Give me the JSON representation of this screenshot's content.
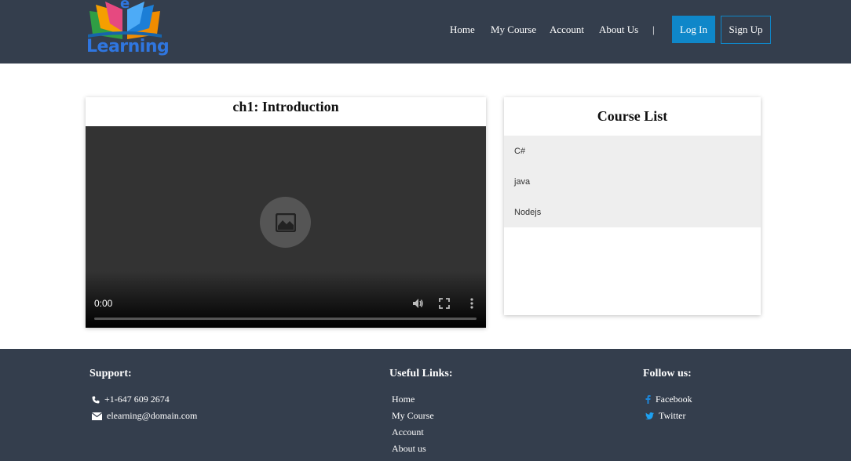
{
  "logo": {
    "letter": "e",
    "word": "Learning"
  },
  "nav": {
    "items": [
      "Home",
      "My Course",
      "Account",
      "About Us"
    ],
    "separator": "|",
    "login_label": "Log In",
    "signup_label": "Sign Up"
  },
  "video": {
    "title": "ch1: Introduction",
    "time": "0:00",
    "progress": 0
  },
  "course_list": {
    "title": "Course List",
    "items": [
      "C#",
      "java",
      "Nodejs"
    ]
  },
  "footer": {
    "support": {
      "heading": "Support:",
      "phone": "+1-647 609 2674",
      "email": "elearning@domain.com"
    },
    "links": {
      "heading": "Useful Links:",
      "items": [
        "Home",
        "My Course",
        "Account",
        "About us"
      ]
    },
    "follow": {
      "heading": "Follow us:",
      "items": [
        "Facebook",
        "Twitter"
      ]
    }
  },
  "colors": {
    "header_bg": "#343e4d",
    "accent": "#0f87c9",
    "logo_blue": "#2f76e0"
  }
}
